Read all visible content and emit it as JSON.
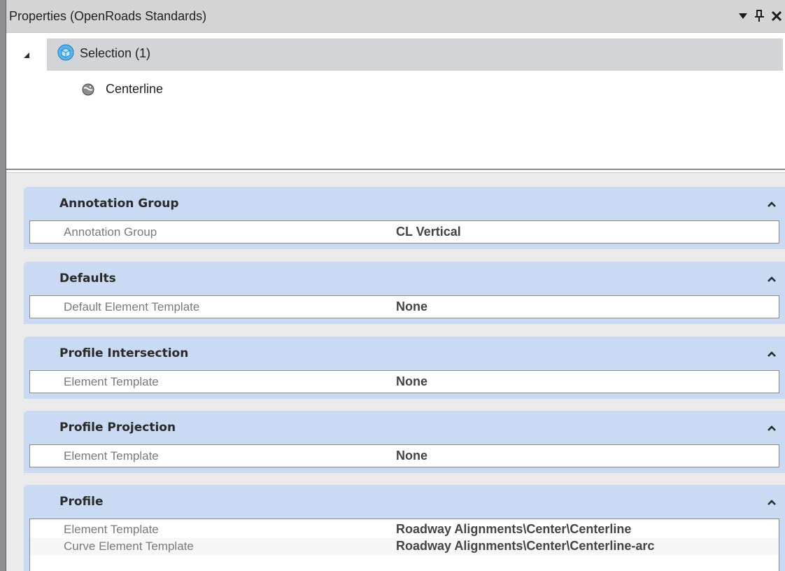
{
  "panel": {
    "title": "Properties (OpenRoads Standards)",
    "title_buttons": {
      "dropdown_icon": "chevron-down-icon",
      "pin_icon": "pin-icon",
      "close_icon": "close-icon"
    }
  },
  "tree": {
    "selection": {
      "label": "Selection (1)",
      "icon": "selection-cube-icon",
      "expanded": true
    },
    "items": [
      {
        "label": "Centerline",
        "icon": "centerline-icon"
      }
    ]
  },
  "groups": [
    {
      "title": "Annotation Group",
      "collapsed": false,
      "properties": [
        {
          "name": "Annotation Group",
          "value": "CL Vertical"
        }
      ]
    },
    {
      "title": "Defaults",
      "collapsed": false,
      "properties": [
        {
          "name": "Default Element Template",
          "value": "None"
        }
      ]
    },
    {
      "title": "Profile Intersection",
      "collapsed": false,
      "properties": [
        {
          "name": "Element Template",
          "value": "None"
        }
      ]
    },
    {
      "title": "Profile Projection",
      "collapsed": false,
      "properties": [
        {
          "name": "Element Template",
          "value": "None"
        }
      ]
    },
    {
      "title": "Profile",
      "collapsed": false,
      "properties": [
        {
          "name": "Element Template",
          "value": "Roadway Alignments\\Center\\Centerline"
        },
        {
          "name": "Curve Element Template",
          "value": "Roadway Alignments\\Center\\Centerline-arc"
        }
      ]
    }
  ],
  "colors": {
    "group_header": "#c9daf2",
    "selected_row": "#d3d4d8",
    "title_bar": "#d4d4d4"
  }
}
